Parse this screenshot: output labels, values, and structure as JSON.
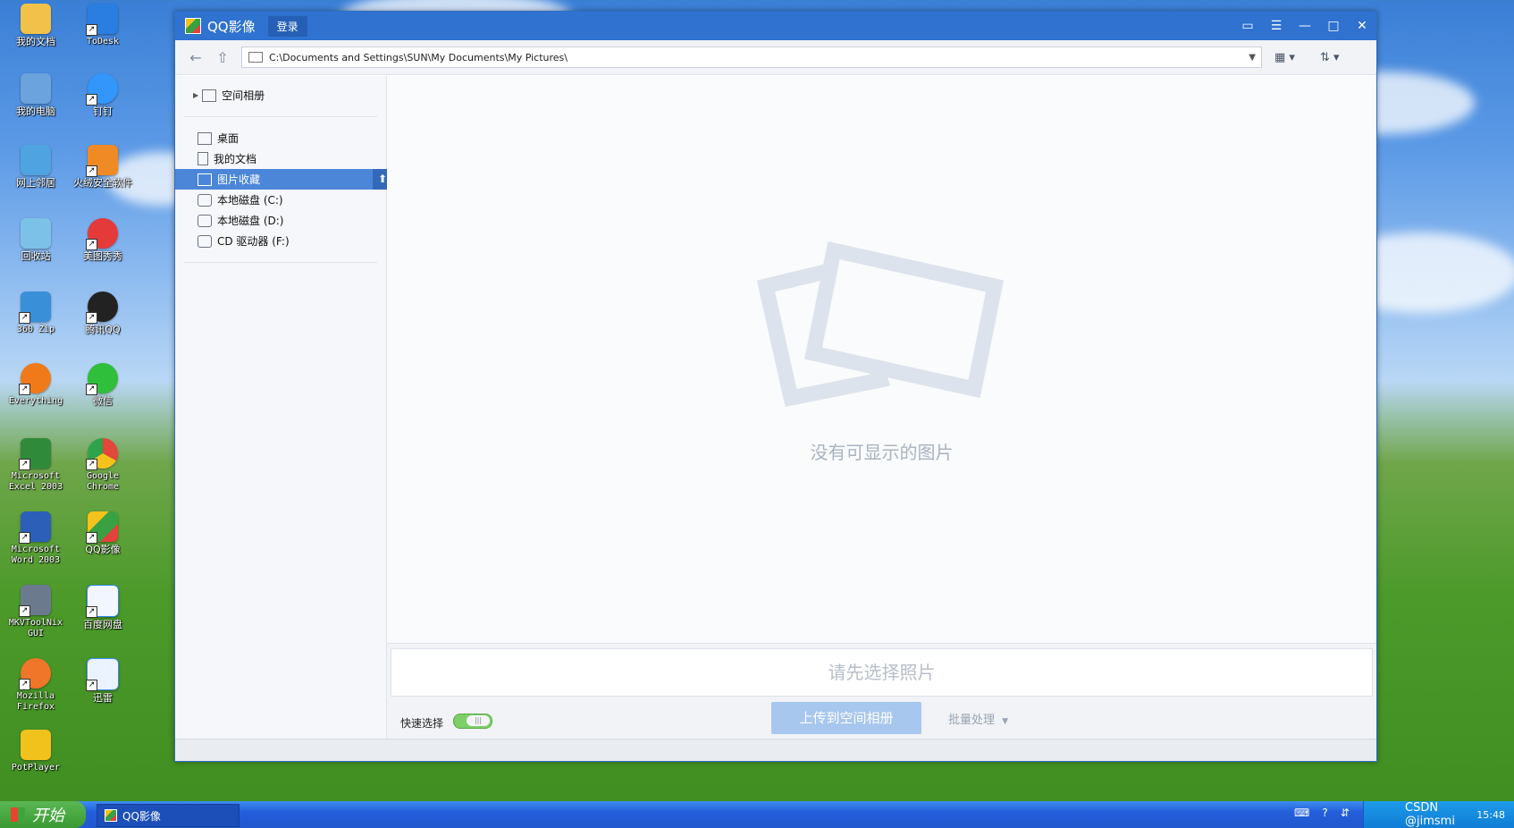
{
  "desktop": {
    "icons": [
      {
        "label": "我的文档",
        "icon": "my-documents-icon",
        "color": "#f2c14a"
      },
      {
        "label": "ToDesk",
        "icon": "todesk-icon",
        "color": "#2a7de1"
      },
      {
        "label": "我的电脑",
        "icon": "my-computer-icon",
        "color": "#6aa3dd"
      },
      {
        "label": "钉钉",
        "icon": "dingtalk-icon",
        "color": "#3296fa"
      },
      {
        "label": "网上邻居",
        "icon": "network-icon",
        "color": "#4fa3e0"
      },
      {
        "label": "火绒安全软件",
        "icon": "huorong-icon",
        "color": "#f08a24"
      },
      {
        "label": "回收站",
        "icon": "recycle-bin-icon",
        "color": "#7cc2e8"
      },
      {
        "label": "美图秀秀",
        "icon": "meitu-icon",
        "color": "#e43a3a"
      },
      {
        "label": "360 Zip",
        "icon": "zip-icon",
        "color": "#3a8fd9"
      },
      {
        "label": "腾讯QQ",
        "icon": "qq-icon",
        "color": "#222222"
      },
      {
        "label": "Everything",
        "icon": "everything-icon",
        "color": "#f07a1a"
      },
      {
        "label": "微信",
        "icon": "wechat-icon",
        "color": "#2fbf3a"
      },
      {
        "label": "Microsoft Excel 2003",
        "icon": "excel-icon",
        "color": "#2f8a3a"
      },
      {
        "label": "Google Chrome",
        "icon": "chrome-icon",
        "color": "#e3463b"
      },
      {
        "label": "Microsoft Word 2003",
        "icon": "word-icon",
        "color": "#2c5fb8"
      },
      {
        "label": "QQ影像",
        "icon": "qq-image-icon",
        "color": "#e6b923"
      },
      {
        "label": "MKVToolNix GUI",
        "icon": "mkvtoolnix-icon",
        "color": "#6c7a8e"
      },
      {
        "label": "百度网盘",
        "icon": "baidu-netdisk-icon",
        "color": "#2d8cf0"
      },
      {
        "label": "Mozilla Firefox",
        "icon": "firefox-icon",
        "color": "#f0762a"
      },
      {
        "label": "迅雷",
        "icon": "xunlei-icon",
        "color": "#3d8fe6"
      },
      {
        "label": "PotPlayer",
        "icon": "potplayer-icon",
        "color": "#f2c21c"
      }
    ]
  },
  "window": {
    "title": "QQ影像",
    "login_label": "登录",
    "path": "C:\\Documents and Settings\\SUN\\My Documents\\My Pictures\\",
    "sidebar": {
      "album": "空间相册",
      "items": [
        {
          "label": "桌面",
          "icon": "desktop-icon"
        },
        {
          "label": "我的文档",
          "icon": "document-icon"
        },
        {
          "label": "图片收藏",
          "icon": "picture-icon",
          "selected": true
        },
        {
          "label": "本地磁盘 (C:)",
          "icon": "drive-icon"
        },
        {
          "label": "本地磁盘 (D:)",
          "icon": "drive-icon"
        },
        {
          "label": "CD 驱动器 (F:)",
          "icon": "cd-drive-icon"
        }
      ]
    },
    "main": {
      "empty_text": "没有可显示的图片",
      "hint": "请先选择照片",
      "quick_select_label": "快速选择",
      "upload_label": "上传到空间相册",
      "batch_label": "批量处理"
    }
  },
  "taskbar": {
    "start_label": "开始",
    "task_label": "QQ影像",
    "watermark": "CSDN @jimsmi",
    "clock": "15:48"
  },
  "colors": {
    "titlebar": "#2f72d0",
    "selected": "#4c86d9",
    "upload": "#a8c7ee",
    "taskbar": "#245edb"
  }
}
